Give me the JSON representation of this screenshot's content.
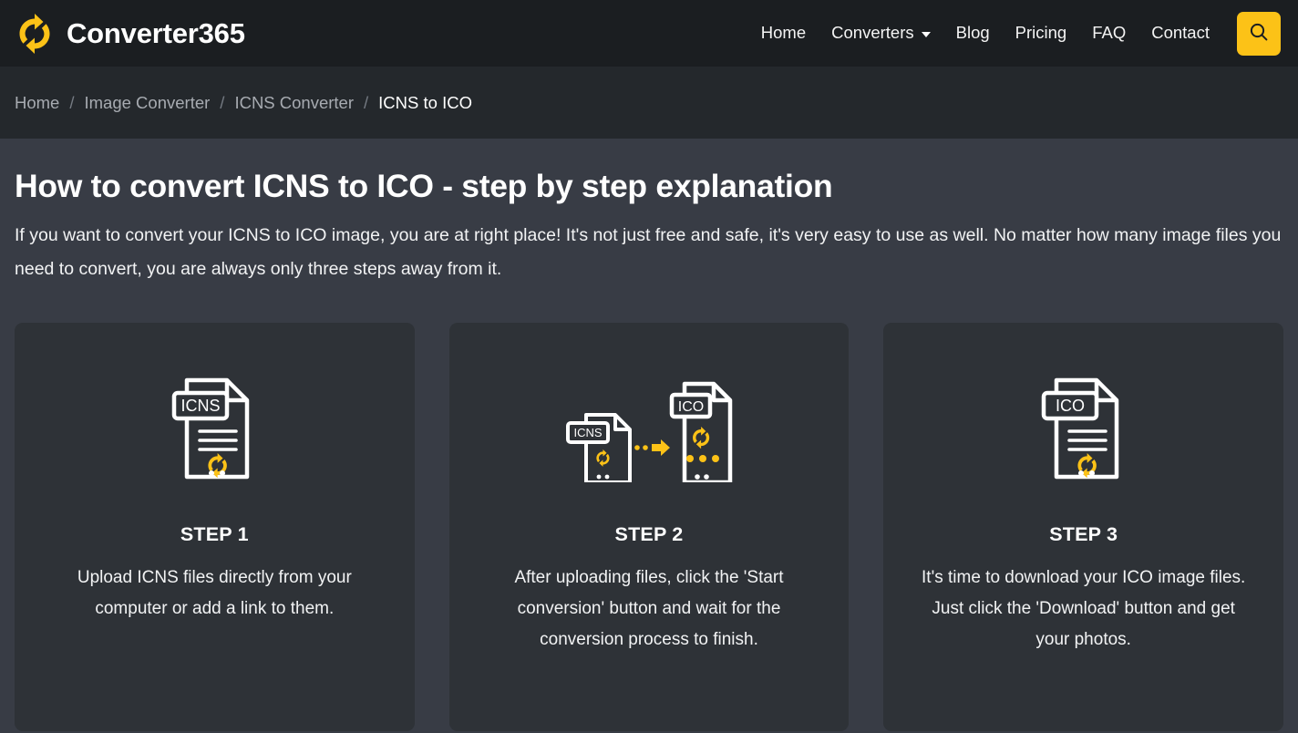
{
  "header": {
    "brand_name": "Converter365",
    "brand_icon": "refresh-sync-icon",
    "nav": [
      {
        "label": "Home",
        "has_dropdown": false
      },
      {
        "label": "Converters",
        "has_dropdown": true
      },
      {
        "label": "Blog",
        "has_dropdown": false
      },
      {
        "label": "Pricing",
        "has_dropdown": false
      },
      {
        "label": "FAQ",
        "has_dropdown": false
      },
      {
        "label": "Contact",
        "has_dropdown": false
      }
    ],
    "search_icon": "search-icon"
  },
  "breadcrumb": {
    "items": [
      {
        "label": "Home",
        "current": false
      },
      {
        "label": "Image Converter",
        "current": false
      },
      {
        "label": "ICNS Converter",
        "current": false
      },
      {
        "label": "ICNS to ICO",
        "current": true
      }
    ],
    "separator": "/"
  },
  "main": {
    "title": "How to convert ICNS to ICO - step by step explanation",
    "intro": "If you want to convert your ICNS to ICO image, you are at right place! It's not just free and safe, it's very easy to use as well. No matter how many image files you need to convert, you are always only three steps away from it.",
    "steps": [
      {
        "icon": "icns-file-icon",
        "file_label": "ICNS",
        "title": "STEP 1",
        "description": "Upload ICNS files directly from your computer or add a link to them."
      },
      {
        "icon": "icns-to-ico-conversion-icon",
        "file_label_from": "ICNS",
        "file_label_to": "ICO",
        "title": "STEP 2",
        "description": "After uploading files, click the 'Start conversion' button and wait for the conversion process to finish."
      },
      {
        "icon": "ico-file-icon",
        "file_label": "ICO",
        "title": "STEP 3",
        "description": "It's time to download your ICO image files. Just click the 'Download' button and get your photos."
      }
    ]
  },
  "colors": {
    "accent_yellow": "#fcc217",
    "header_bg": "#1b1e21",
    "breadcrumb_bg": "#24282c",
    "page_bg": "#383c45",
    "card_bg": "#2e3237"
  }
}
